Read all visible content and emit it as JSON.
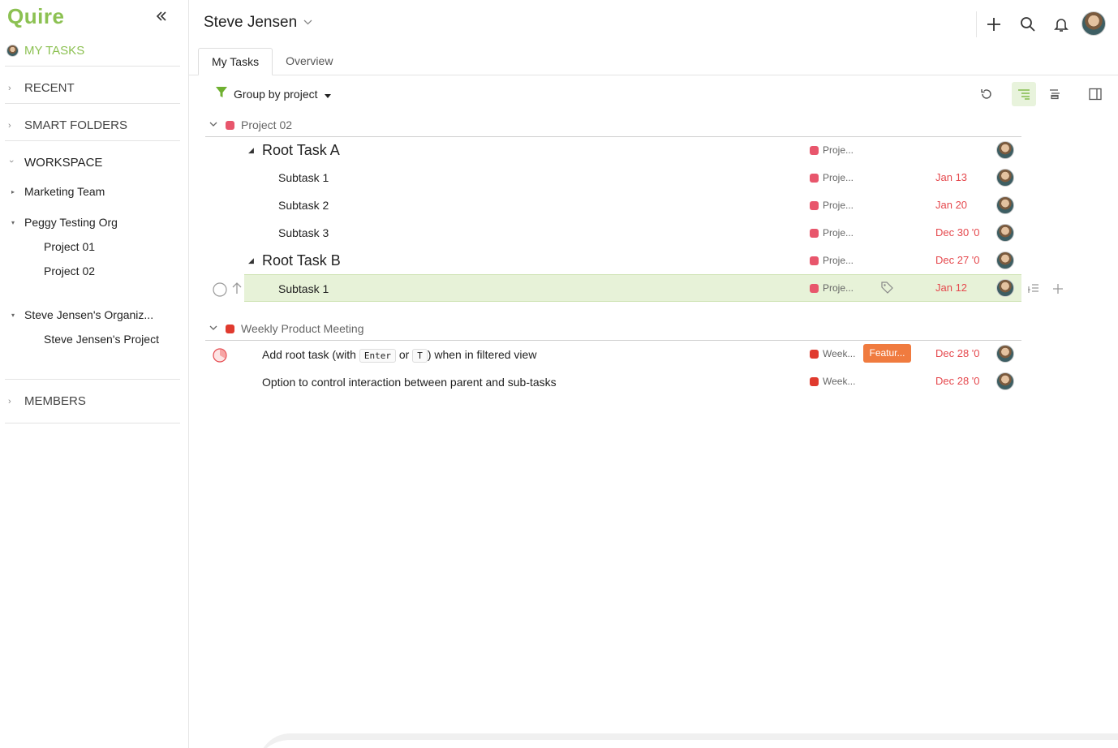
{
  "sidebar": {
    "logo": "Quire",
    "my_tasks": "MY TASKS",
    "sections": {
      "recent": "RECENT",
      "smart_folders": "SMART FOLDERS",
      "workspace": "WORKSPACE",
      "members": "MEMBERS"
    },
    "workspace_items": {
      "marketing_team": "Marketing Team",
      "peggy_org": "Peggy Testing Org",
      "project_01": "Project 01",
      "project_02": "Project 02",
      "steve_org": "Steve Jensen's Organiz...",
      "steve_project": "Steve Jensen's Project"
    }
  },
  "header": {
    "title": "Steve Jensen"
  },
  "tabs": {
    "my_tasks": "My Tasks",
    "overview": "Overview"
  },
  "toolbar": {
    "group_by": "Group by project"
  },
  "groups": {
    "project02": {
      "name": "Project 02",
      "color": "#e8566c",
      "rows": {
        "root_a": {
          "name": "Root Task A",
          "project": "Proje...",
          "date": ""
        },
        "sub_a1": {
          "name": "Subtask 1",
          "project": "Proje...",
          "date": "Jan 13"
        },
        "sub_a2": {
          "name": "Subtask 2",
          "project": "Proje...",
          "date": "Jan 20"
        },
        "sub_a3": {
          "name": "Subtask 3",
          "project": "Proje...",
          "date": "Dec 30 '0"
        },
        "root_b": {
          "name": "Root Task B",
          "project": "Proje...",
          "date": "Dec 27 '0"
        },
        "sub_b1": {
          "name": "Subtask 1",
          "project": "Proje...",
          "date": "Jan 12"
        }
      }
    },
    "weekly": {
      "name": "Weekly Product Meeting",
      "color": "#e03a2e",
      "rows": {
        "task1": {
          "prefix": "Add root task (with",
          "kbd1": "Enter",
          "mid": "or",
          "kbd2": "T",
          "suffix": ") when in filtered view",
          "project": "Week...",
          "tag": "Featur...",
          "tag_color": "#f07b3f",
          "date": "Dec 28 '0"
        },
        "task2": {
          "name": "Option to control interaction between parent and sub-tasks",
          "project": "Week...",
          "date": "Dec 28 '0"
        }
      }
    }
  },
  "colors": {
    "brand_green": "#8cc152",
    "due_red": "#e5484d",
    "selected_row": "#e7f2d8"
  }
}
